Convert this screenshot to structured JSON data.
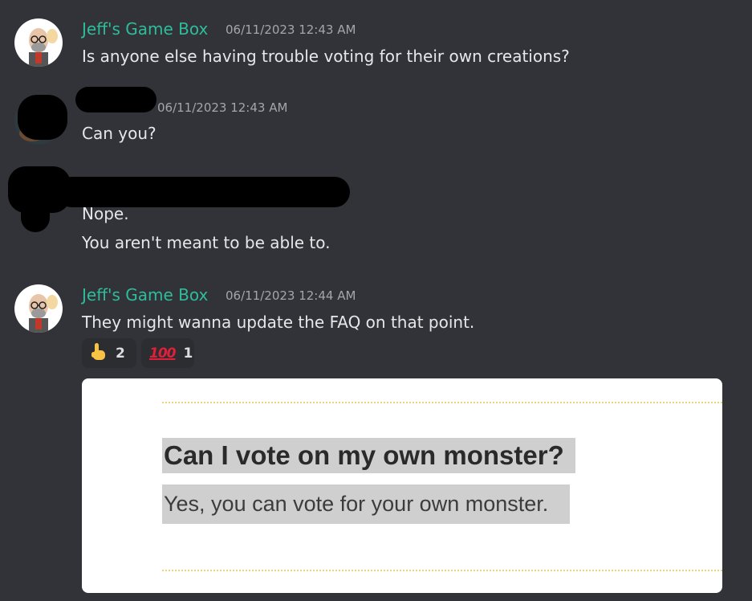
{
  "messages": [
    {
      "username": "Jeff's Game Box",
      "timestamp": "06/11/2023 12:43 AM",
      "lines": [
        "Is anyone else having trouble voting for their own creations?"
      ]
    },
    {
      "username": "",
      "timestamp": "06/11/2023 12:43 AM",
      "lines": [
        "Can you?"
      ]
    },
    {
      "username": "",
      "timestamp": "",
      "lines": [
        "Nope.",
        "You aren't meant to be able to."
      ]
    },
    {
      "username": "Jeff's Game Box",
      "timestamp": "06/11/2023 12:44 AM",
      "lines": [
        "They might wanna update the FAQ on that point."
      ],
      "reactions": [
        {
          "emoji": "point-up",
          "count": "2"
        },
        {
          "emoji": "hundred-points",
          "count": "1",
          "glyph": "100"
        }
      ]
    }
  ],
  "embed": {
    "question": "Can I vote on my own monster?",
    "answer": "Yes, you can vote for your own monster."
  },
  "colors": {
    "background": "#313338",
    "username": "#2ebd9a",
    "timestamp": "#a3a6aa",
    "text": "#e6e7e9",
    "reaction_bg": "#2b2d31"
  }
}
